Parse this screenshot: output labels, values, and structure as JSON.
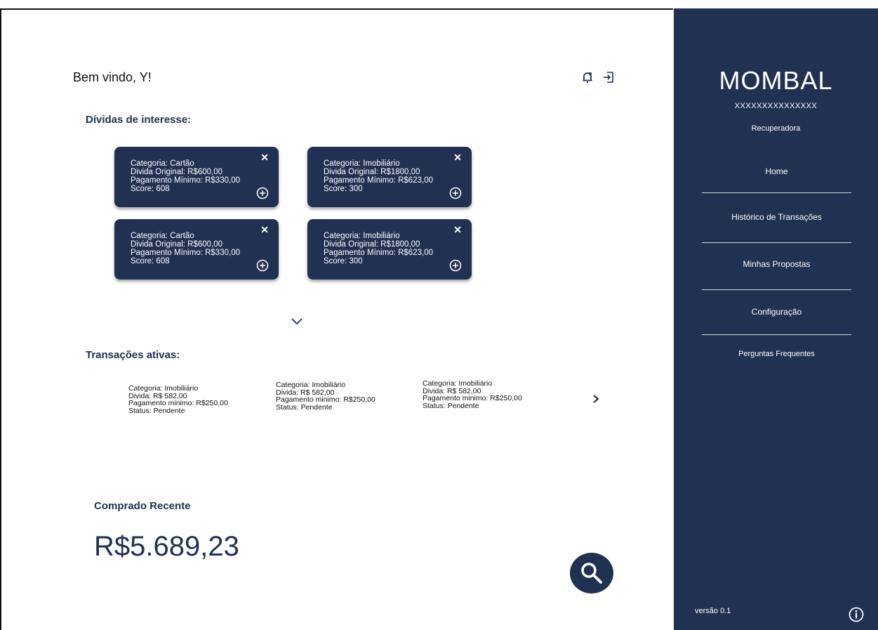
{
  "header": {
    "welcome": "Bem vindo, Y!",
    "icons": [
      "bell-icon",
      "logout-icon"
    ]
  },
  "debts": {
    "title": "Dívidas de interesse:",
    "cards": [
      {
        "lines": [
          "Categoria: Cartão",
          "Divida Original: R$600,00",
          "Pagamento Mínimo: R$330,00",
          "Score: 608"
        ],
        "close": "✕"
      },
      {
        "lines": [
          "Categoria: Imobiliário",
          "Divida Original: R$1800,00",
          "Pagamento Mínimo: R$623,00",
          "Score: 300"
        ],
        "close": "✕"
      },
      {
        "lines": [
          "Categoria: Cartão",
          "Divida Original: R$600,00",
          "Pagamento Mínimo: R$330,00",
          "Score: 608"
        ],
        "close": "✕"
      },
      {
        "lines": [
          "Categoria: Imobiliário",
          "Divida Original: R$1800,00",
          "Pagamento Mínimo: R$623,00",
          "Score: 300"
        ],
        "close": "✕"
      }
    ]
  },
  "transactions": {
    "title": "Transações ativas:",
    "items": [
      {
        "lines": [
          "Categoria: Imobiliário",
          "Divida: R$ 582,00",
          "Pagamento minimo: R$250,00",
          "Status: Pendente"
        ]
      },
      {
        "lines": [
          "Categoria: Imobiliário",
          "Divida: R$ 582,00",
          "Pagamento minimo: R$250,00",
          "Status: Pendente"
        ]
      },
      {
        "lines": [
          "Categoria: Imobiliário",
          "Divida: R$ 582,00",
          "Pagamento minimo: R$250,00",
          "Status: Pendente"
        ]
      }
    ]
  },
  "recent": {
    "title": "Comprado Recente",
    "amount": "R$5.689,23"
  },
  "sidebar": {
    "brand": "MOMBAL",
    "account": "XXXXXXXXXXXXXXX",
    "role": "Recuperadora",
    "nav": [
      {
        "label": "Home"
      },
      {
        "label": "Histórico de Transações"
      },
      {
        "label": "Minhas Propostas"
      },
      {
        "label": "Configuração"
      },
      {
        "label": "Perguntas Frequentes"
      }
    ],
    "version": "versão 0.1"
  },
  "colors": {
    "primary": "#213151",
    "background": "#ffffff"
  }
}
